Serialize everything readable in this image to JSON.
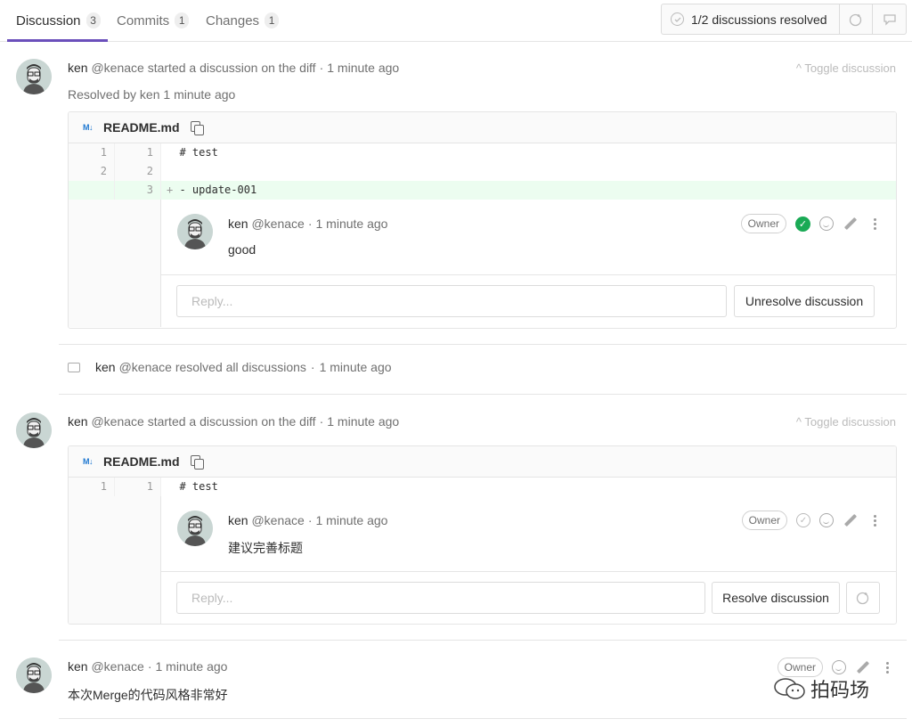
{
  "tabs": [
    {
      "label": "Discussion",
      "count": "3"
    },
    {
      "label": "Commits",
      "count": "1"
    },
    {
      "label": "Changes",
      "count": "1"
    }
  ],
  "resolved_status": "1/2 discussions resolved",
  "discussion1": {
    "author": "ken",
    "handle": "@kenace",
    "action": "started a discussion on the diff",
    "time": "1 minute ago",
    "toggle": "Toggle discussion",
    "resolved_by": "Resolved by ken 1 minute ago",
    "file_icon": "M↓",
    "file_name": "README.md",
    "lines": [
      {
        "old": "1",
        "new": "1",
        "code": "# test",
        "type": "context"
      },
      {
        "old": "2",
        "new": "2",
        "code": "",
        "type": "context"
      },
      {
        "old": "",
        "new": "3",
        "code": "- update-001",
        "sign": "+",
        "type": "added"
      }
    ],
    "note": {
      "author": "ken",
      "handle": "@kenace",
      "time": "1 minute ago",
      "badge": "Owner",
      "body": "good"
    },
    "reply_placeholder": "Reply...",
    "button": "Unresolve discussion"
  },
  "system_note": {
    "author": "ken",
    "text": "@kenace resolved all discussions",
    "time": "1 minute ago"
  },
  "discussion2": {
    "author": "ken",
    "handle": "@kenace",
    "action": "started a discussion on the diff",
    "time": "1 minute ago",
    "toggle": "Toggle discussion",
    "file_icon": "M↓",
    "file_name": "README.md",
    "lines": [
      {
        "old": "1",
        "new": "1",
        "code": "# test",
        "type": "context"
      }
    ],
    "note": {
      "author": "ken",
      "handle": "@kenace",
      "time": "1 minute ago",
      "badge": "Owner",
      "body": "建议完善标题"
    },
    "reply_placeholder": "Reply...",
    "button": "Resolve discussion"
  },
  "comment": {
    "author": "ken",
    "handle": "@kenace",
    "time": "1 minute ago",
    "badge": "Owner",
    "body": "本次Merge的代码风格非常好"
  },
  "watermark": "拍码场",
  "separator": "·",
  "chevron": "^",
  "plus": "+",
  "icons": [
    "check-circle-icon",
    "add-reaction-icon",
    "comment-icon",
    "smiley-icon",
    "edit-icon",
    "more-actions-icon",
    "copy-icon",
    "markdown-icon"
  ],
  "colors": {
    "accent": "#6b4fbb",
    "resolved_green": "#1aaa55",
    "added_line": "#ecfdf0",
    "link_blue": "#1f78d1"
  }
}
